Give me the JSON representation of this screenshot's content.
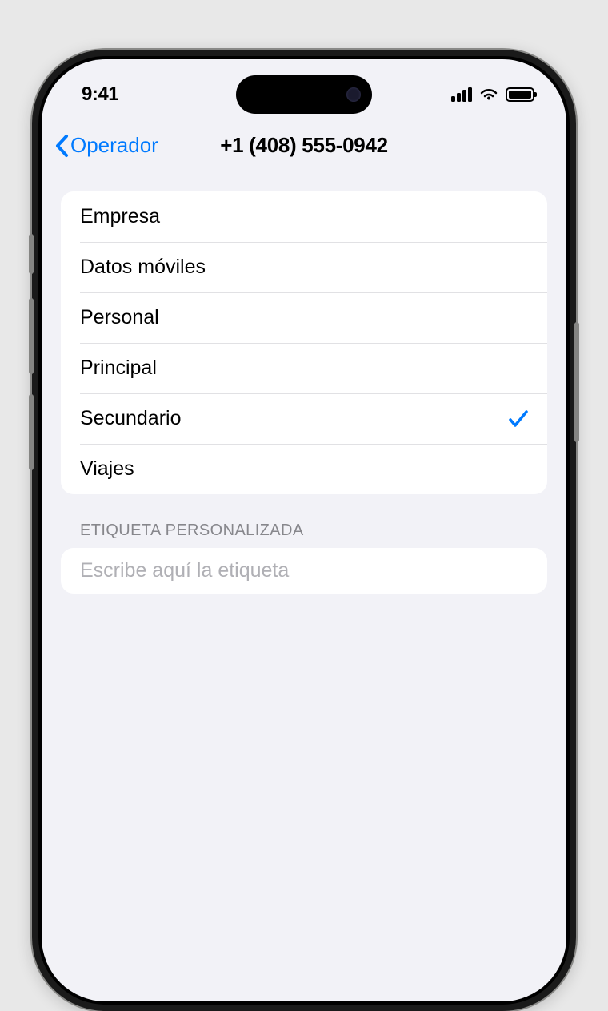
{
  "status": {
    "time": "9:41"
  },
  "nav": {
    "back_label": "Operador",
    "title": "+1 (408) 555-0942"
  },
  "labels": [
    {
      "name": "Empresa",
      "selected": false
    },
    {
      "name": "Datos móviles",
      "selected": false
    },
    {
      "name": "Personal",
      "selected": false
    },
    {
      "name": "Principal",
      "selected": false
    },
    {
      "name": "Secundario",
      "selected": true
    },
    {
      "name": "Viajes",
      "selected": false
    }
  ],
  "custom_section": {
    "header": "ETIQUETA PERSONALIZADA",
    "placeholder": "Escribe aquí la etiqueta",
    "value": ""
  }
}
